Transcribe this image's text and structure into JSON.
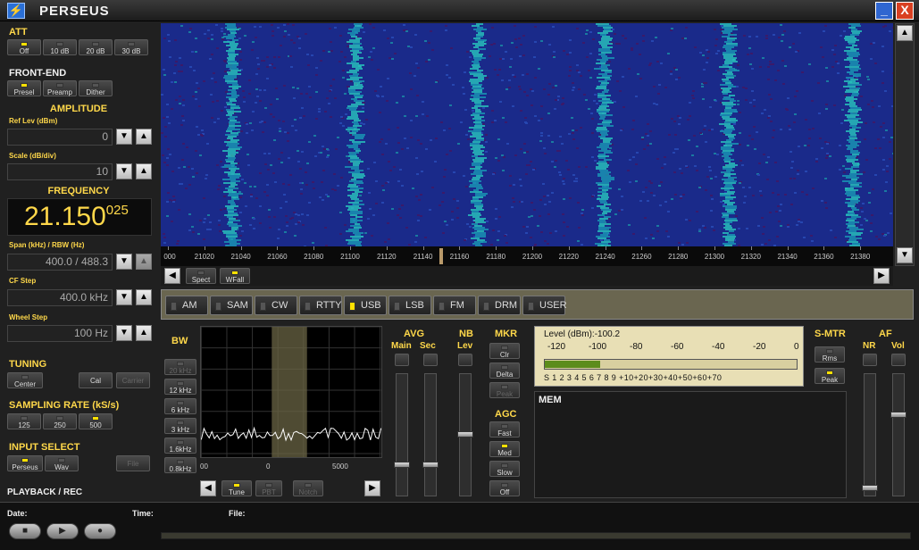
{
  "window": {
    "title": "PERSEUS",
    "minimize_label": "_",
    "close_label": "X"
  },
  "att": {
    "title": "ATT",
    "buttons": [
      {
        "label": "Off",
        "on": true
      },
      {
        "label": "10 dB",
        "on": false
      },
      {
        "label": "20 dB",
        "on": false
      },
      {
        "label": "30 dB",
        "on": false
      }
    ]
  },
  "frontend": {
    "title": "FRONT-END",
    "buttons": [
      {
        "label": "Presel",
        "on": true
      },
      {
        "label": "Preamp",
        "on": false
      },
      {
        "label": "Dither",
        "on": false
      }
    ]
  },
  "amplitude": {
    "title": "AMPLITUDE",
    "ref_label": "Ref Lev (dBm)",
    "ref_value": "0",
    "scale_label": "Scale (dB/div)",
    "scale_value": "10"
  },
  "frequency": {
    "title": "FREQUENCY",
    "main": "21.150",
    "fine": "025",
    "span_label": "Span (kHz) / RBW (Hz)",
    "span_value": "400.0 / 488.3",
    "cfstep_label": "CF Step",
    "cfstep_value": "400.0 kHz",
    "wheel_label": "Wheel Step",
    "wheel_value": "100 Hz"
  },
  "tuning": {
    "title": "TUNING",
    "center": "Center",
    "cal": "Cal",
    "carrier": "Carrier"
  },
  "sampling": {
    "title": "SAMPLING RATE (kS/s)",
    "buttons": [
      {
        "label": "125",
        "on": false
      },
      {
        "label": "250",
        "on": false
      },
      {
        "label": "500",
        "on": true
      }
    ]
  },
  "input": {
    "title": "INPUT SELECT",
    "perseus": "Perseus",
    "wav": "Wav",
    "file": "File"
  },
  "playback": {
    "title": "PLAYBACK / REC",
    "date_label": "Date:",
    "time_label": "Time:",
    "file_label": "File:"
  },
  "freq_axis": {
    "ticks": [
      "000",
      "21020",
      "21040",
      "21060",
      "21080",
      "21100",
      "21120",
      "21140",
      "21160",
      "21180",
      "21200",
      "21220",
      "21240",
      "21260",
      "21280",
      "21300",
      "21320",
      "21340",
      "21360",
      "21380"
    ]
  },
  "nav": {
    "spect": "Spect",
    "wfall": "WFall"
  },
  "modes": [
    {
      "label": "AM",
      "on": false
    },
    {
      "label": "SAM",
      "on": false
    },
    {
      "label": "CW",
      "on": false
    },
    {
      "label": "RTTY",
      "on": false
    },
    {
      "label": "USB",
      "on": true
    },
    {
      "label": "LSB",
      "on": false
    },
    {
      "label": "FM",
      "on": false
    },
    {
      "label": "DRM",
      "on": false
    },
    {
      "label": "USER",
      "on": false
    }
  ],
  "bw": {
    "title": "BW",
    "buttons": [
      {
        "label": "20 kHz",
        "on": false,
        "dis": true
      },
      {
        "label": "12 kHz",
        "on": false
      },
      {
        "label": "6 kHz",
        "on": false
      },
      {
        "label": "3 kHz",
        "on": false
      },
      {
        "label": "1.6kHz",
        "on": false
      },
      {
        "label": "0.8kHz",
        "on": false
      }
    ],
    "axis": [
      "00",
      "0",
      "5000"
    ]
  },
  "filter_nav": {
    "tune": "Tune",
    "pbt": "PBT",
    "notch": "Notch"
  },
  "avg": {
    "title": "AVG",
    "main": "Main",
    "sec": "Sec"
  },
  "nb": {
    "title": "NB",
    "lev": "Lev"
  },
  "mkr": {
    "title": "MKR",
    "clr": "Clr",
    "delta": "Delta",
    "peak": "Peak"
  },
  "agc": {
    "title": "AGC",
    "buttons": [
      {
        "label": "Fast",
        "on": false
      },
      {
        "label": "Med",
        "on": true
      },
      {
        "label": "Slow",
        "on": false
      },
      {
        "label": "Off",
        "on": false
      }
    ]
  },
  "meter": {
    "level_label": "Level (dBm):",
    "level_value": "-100.2",
    "top_scale": [
      "-120",
      "-100",
      "-80",
      "-60",
      "-40",
      "-20",
      "0"
    ],
    "bottom_scale": "S 1 2 3 4 5 6 7 8 9 +10+20+30+40+50+60+70",
    "fill_fraction": 0.22
  },
  "smtr": {
    "title": "S-MTR",
    "rms": "Rms",
    "peak": "Peak"
  },
  "mem": {
    "title": "MEM"
  },
  "af": {
    "title": "AF",
    "nr": "NR",
    "vol": "Vol"
  },
  "colors": {
    "accent": "#ffd84a",
    "led_on": "#ffe100",
    "waterfall_bg": "#1a2a8a"
  }
}
